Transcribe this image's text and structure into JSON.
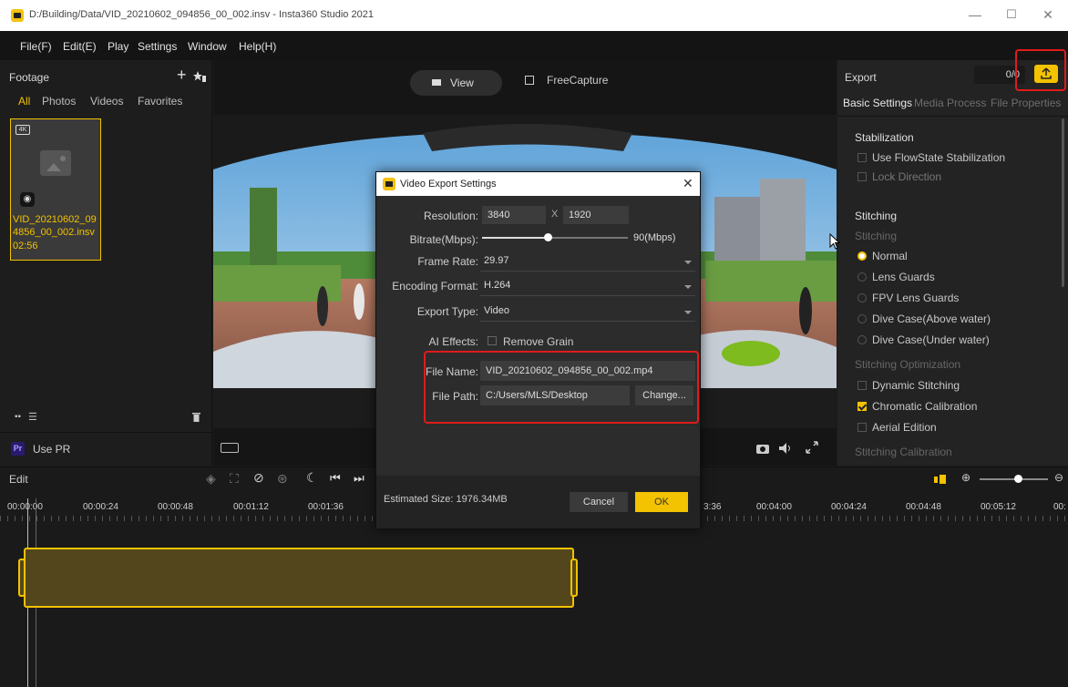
{
  "window": {
    "title": "D:/Building/Data/VID_20210602_094856_00_002.insv - Insta360 Studio 2021",
    "minimize_glyph": "—",
    "maximize_glyph": "☐",
    "close_glyph": "✕"
  },
  "menu": [
    "File(F)",
    "Edit(E)",
    "Play",
    "Settings",
    "Window",
    "Help(H)"
  ],
  "footage": {
    "title": "Footage",
    "tabs": [
      "All",
      "Photos",
      "Videos",
      "Favorites"
    ],
    "item": {
      "badge": "4K",
      "filename_line1": "VID_20210602_09",
      "filename_line2": "4856_00_002.insv",
      "duration": "02:56"
    },
    "use_pr": "Use PR",
    "pr_badge": "Pr"
  },
  "preview": {
    "view_label": "View",
    "freecapture_label": "FreeCapture"
  },
  "export_panel": {
    "title": "Export",
    "counter": "0/0",
    "tabs": [
      "Basic Settings",
      "Media Process",
      "File Properties"
    ],
    "stabilization_title": "Stabilization",
    "use_flowstate": "Use FlowState Stabilization",
    "lock_direction": "Lock Direction",
    "stitching_title": "Stitching",
    "stitching_sub": "Stitching",
    "modes": [
      "Normal",
      "Lens Guards",
      "FPV Lens Guards",
      "Dive Case(Above water)",
      "Dive Case(Under water)"
    ],
    "opt_title": "Stitching Optimization",
    "dynamic_stitching": "Dynamic Stitching",
    "chromatic": "Chromatic Calibration",
    "aerial": "Aerial Edition",
    "calibration_title": "Stitching Calibration"
  },
  "timeline": {
    "edit_label": "Edit",
    "timecodes": [
      "00:00:00",
      "00:00:24",
      "00:00:48",
      "00:01:12",
      "00:01:36",
      "3:36",
      "00:04:00",
      "00:04:24",
      "00:04:48",
      "00:05:12",
      "00:"
    ]
  },
  "dialog": {
    "title": "Video Export Settings",
    "resolution_label": "Resolution:",
    "res_w": "3840",
    "res_x": "X",
    "res_h": "1920",
    "bitrate_label": "Bitrate(Mbps):",
    "bitrate_value": "90(Mbps)",
    "bitrate_fraction": 0.45,
    "framerate_label": "Frame Rate:",
    "framerate_value": "29.97",
    "encoding_label": "Encoding Format:",
    "encoding_value": "H.264",
    "exporttype_label": "Export Type:",
    "exporttype_value": "Video",
    "ai_label": "AI Effects:",
    "remove_grain": "Remove Grain",
    "filename_label": "File Name:",
    "filename_value": "VID_20210602_094856_00_002.mp4",
    "filepath_label": "File Path:",
    "filepath_value": "C:/Users/MLS/Desktop",
    "change_button": "Change...",
    "estimated": "Estimated Size: 1976.34MB",
    "cancel": "Cancel",
    "ok": "OK"
  },
  "colors": {
    "accent": "#f3c200",
    "annotation_red": "#e01b1b"
  }
}
